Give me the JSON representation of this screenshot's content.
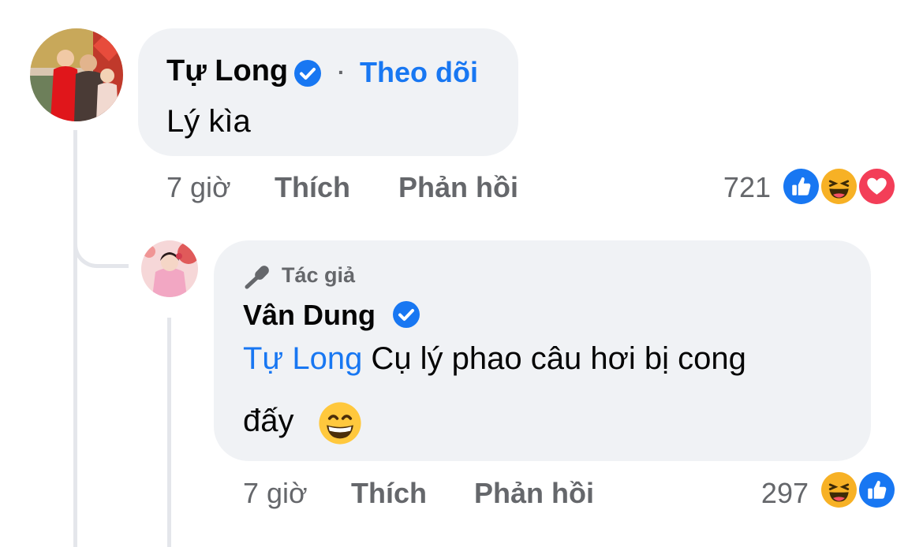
{
  "comment": {
    "author": "Tự Long",
    "follow_label": "Theo dõi",
    "follow_separator": "·",
    "text": "Lý kìa",
    "time": "7 giờ",
    "like_label": "Thích",
    "reply_label": "Phản hồi",
    "reaction_count": "721",
    "reactions": [
      "like-icon",
      "haha-icon",
      "love-icon"
    ]
  },
  "reply": {
    "badge_label": "Tác giả",
    "author": "Vân Dung",
    "mention": "Tự Long",
    "text_line1": " Cụ lý phao câu hơi bị cong",
    "text_line2": "đấy",
    "emoji": "grinning-face-emoji",
    "time": "7 giờ",
    "like_label": "Thích",
    "reply_label": "Phản hồi",
    "reaction_count": "297",
    "reactions": [
      "haha-icon",
      "like-icon"
    ]
  },
  "colors": {
    "link_blue": "#1877f2",
    "bubble_bg": "#f0f2f5",
    "meta_gray": "#65676b",
    "love_red": "#f33e58",
    "haha_yellow": "#f7b125"
  }
}
